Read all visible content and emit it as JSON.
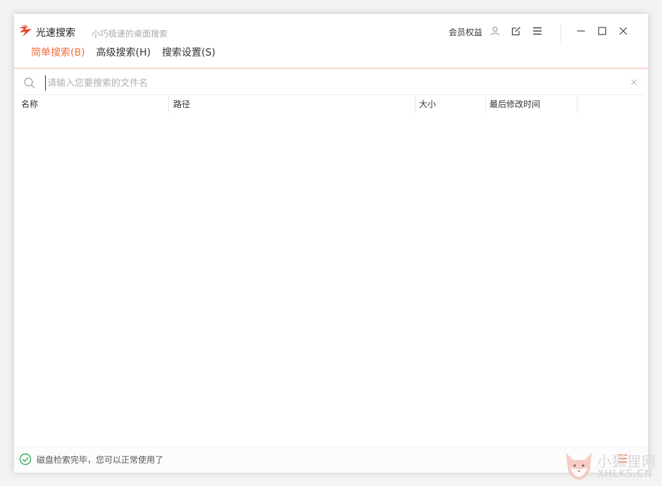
{
  "app": {
    "title": "光速搜索",
    "subtitle": "小巧极速的桌面搜索"
  },
  "titlebar": {
    "member_label": "会员权益",
    "icons": [
      "user-icon",
      "edit-icon",
      "menu-icon",
      "minimize-icon",
      "maximize-icon",
      "close-icon"
    ]
  },
  "tabs": [
    {
      "label": "简单搜索(B)",
      "active": true
    },
    {
      "label": "高级搜索(H)",
      "active": false
    },
    {
      "label": "搜索设置(S)",
      "active": false
    }
  ],
  "search": {
    "value": "",
    "placeholder": "请输入您要搜索的文件名",
    "clear_label": "×"
  },
  "table": {
    "columns": [
      "名称",
      "路径",
      "大小",
      "最后修改时间"
    ],
    "rows": []
  },
  "status": {
    "text": "磁盘检索完毕，您可以正常使用了"
  },
  "watermark": {
    "text": "小狐狸网",
    "domain": "XHLKS.CN"
  },
  "colors": {
    "accent": "#f46b3b",
    "success": "#3cae5c"
  }
}
